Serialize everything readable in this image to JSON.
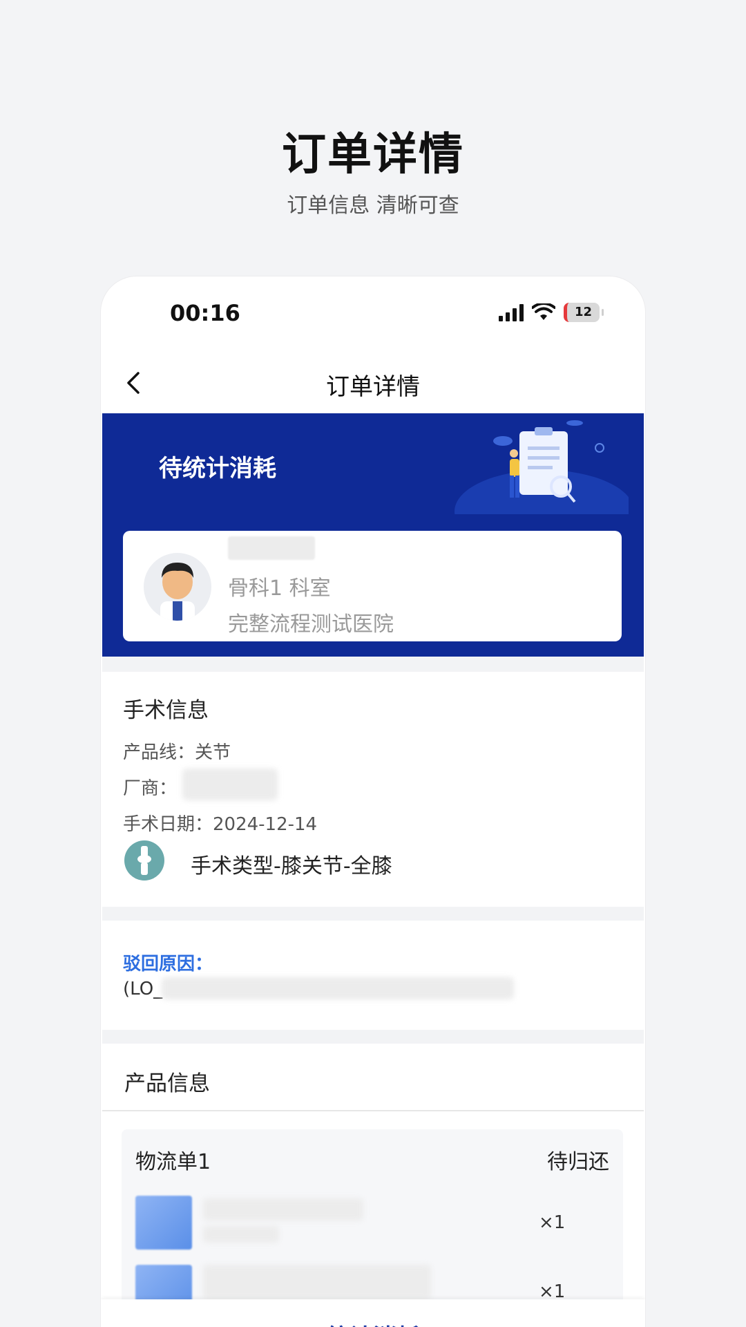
{
  "promo": {
    "title": "订单详情",
    "subtitle": "订单信息 清晰可查"
  },
  "status_bar": {
    "time": "00:16",
    "battery": "12"
  },
  "nav": {
    "back_icon": "chevron-left-icon",
    "title": "订单详情"
  },
  "banner": {
    "status": "待统计消耗",
    "color": "#0f2a96"
  },
  "doctor": {
    "department": "骨科1 科室",
    "hospital": "完整流程测试医院"
  },
  "surgery": {
    "section_title": "手术信息",
    "product_line": "产品线：关节",
    "vendor_label": "厂商：",
    "date": "手术日期：2024-12-14",
    "type": "手术类型-膝关节-全膝"
  },
  "reject": {
    "label": "驳回原因：",
    "text": "(LO_"
  },
  "products": {
    "section_title": "产品信息",
    "logistics": {
      "title": "物流单1",
      "status": "待归还",
      "items": [
        {
          "qty": "×1"
        },
        {
          "qty": "×1"
        }
      ]
    }
  },
  "bottom": {
    "button_label": "统计消耗",
    "accent": "#1f3fa8"
  }
}
